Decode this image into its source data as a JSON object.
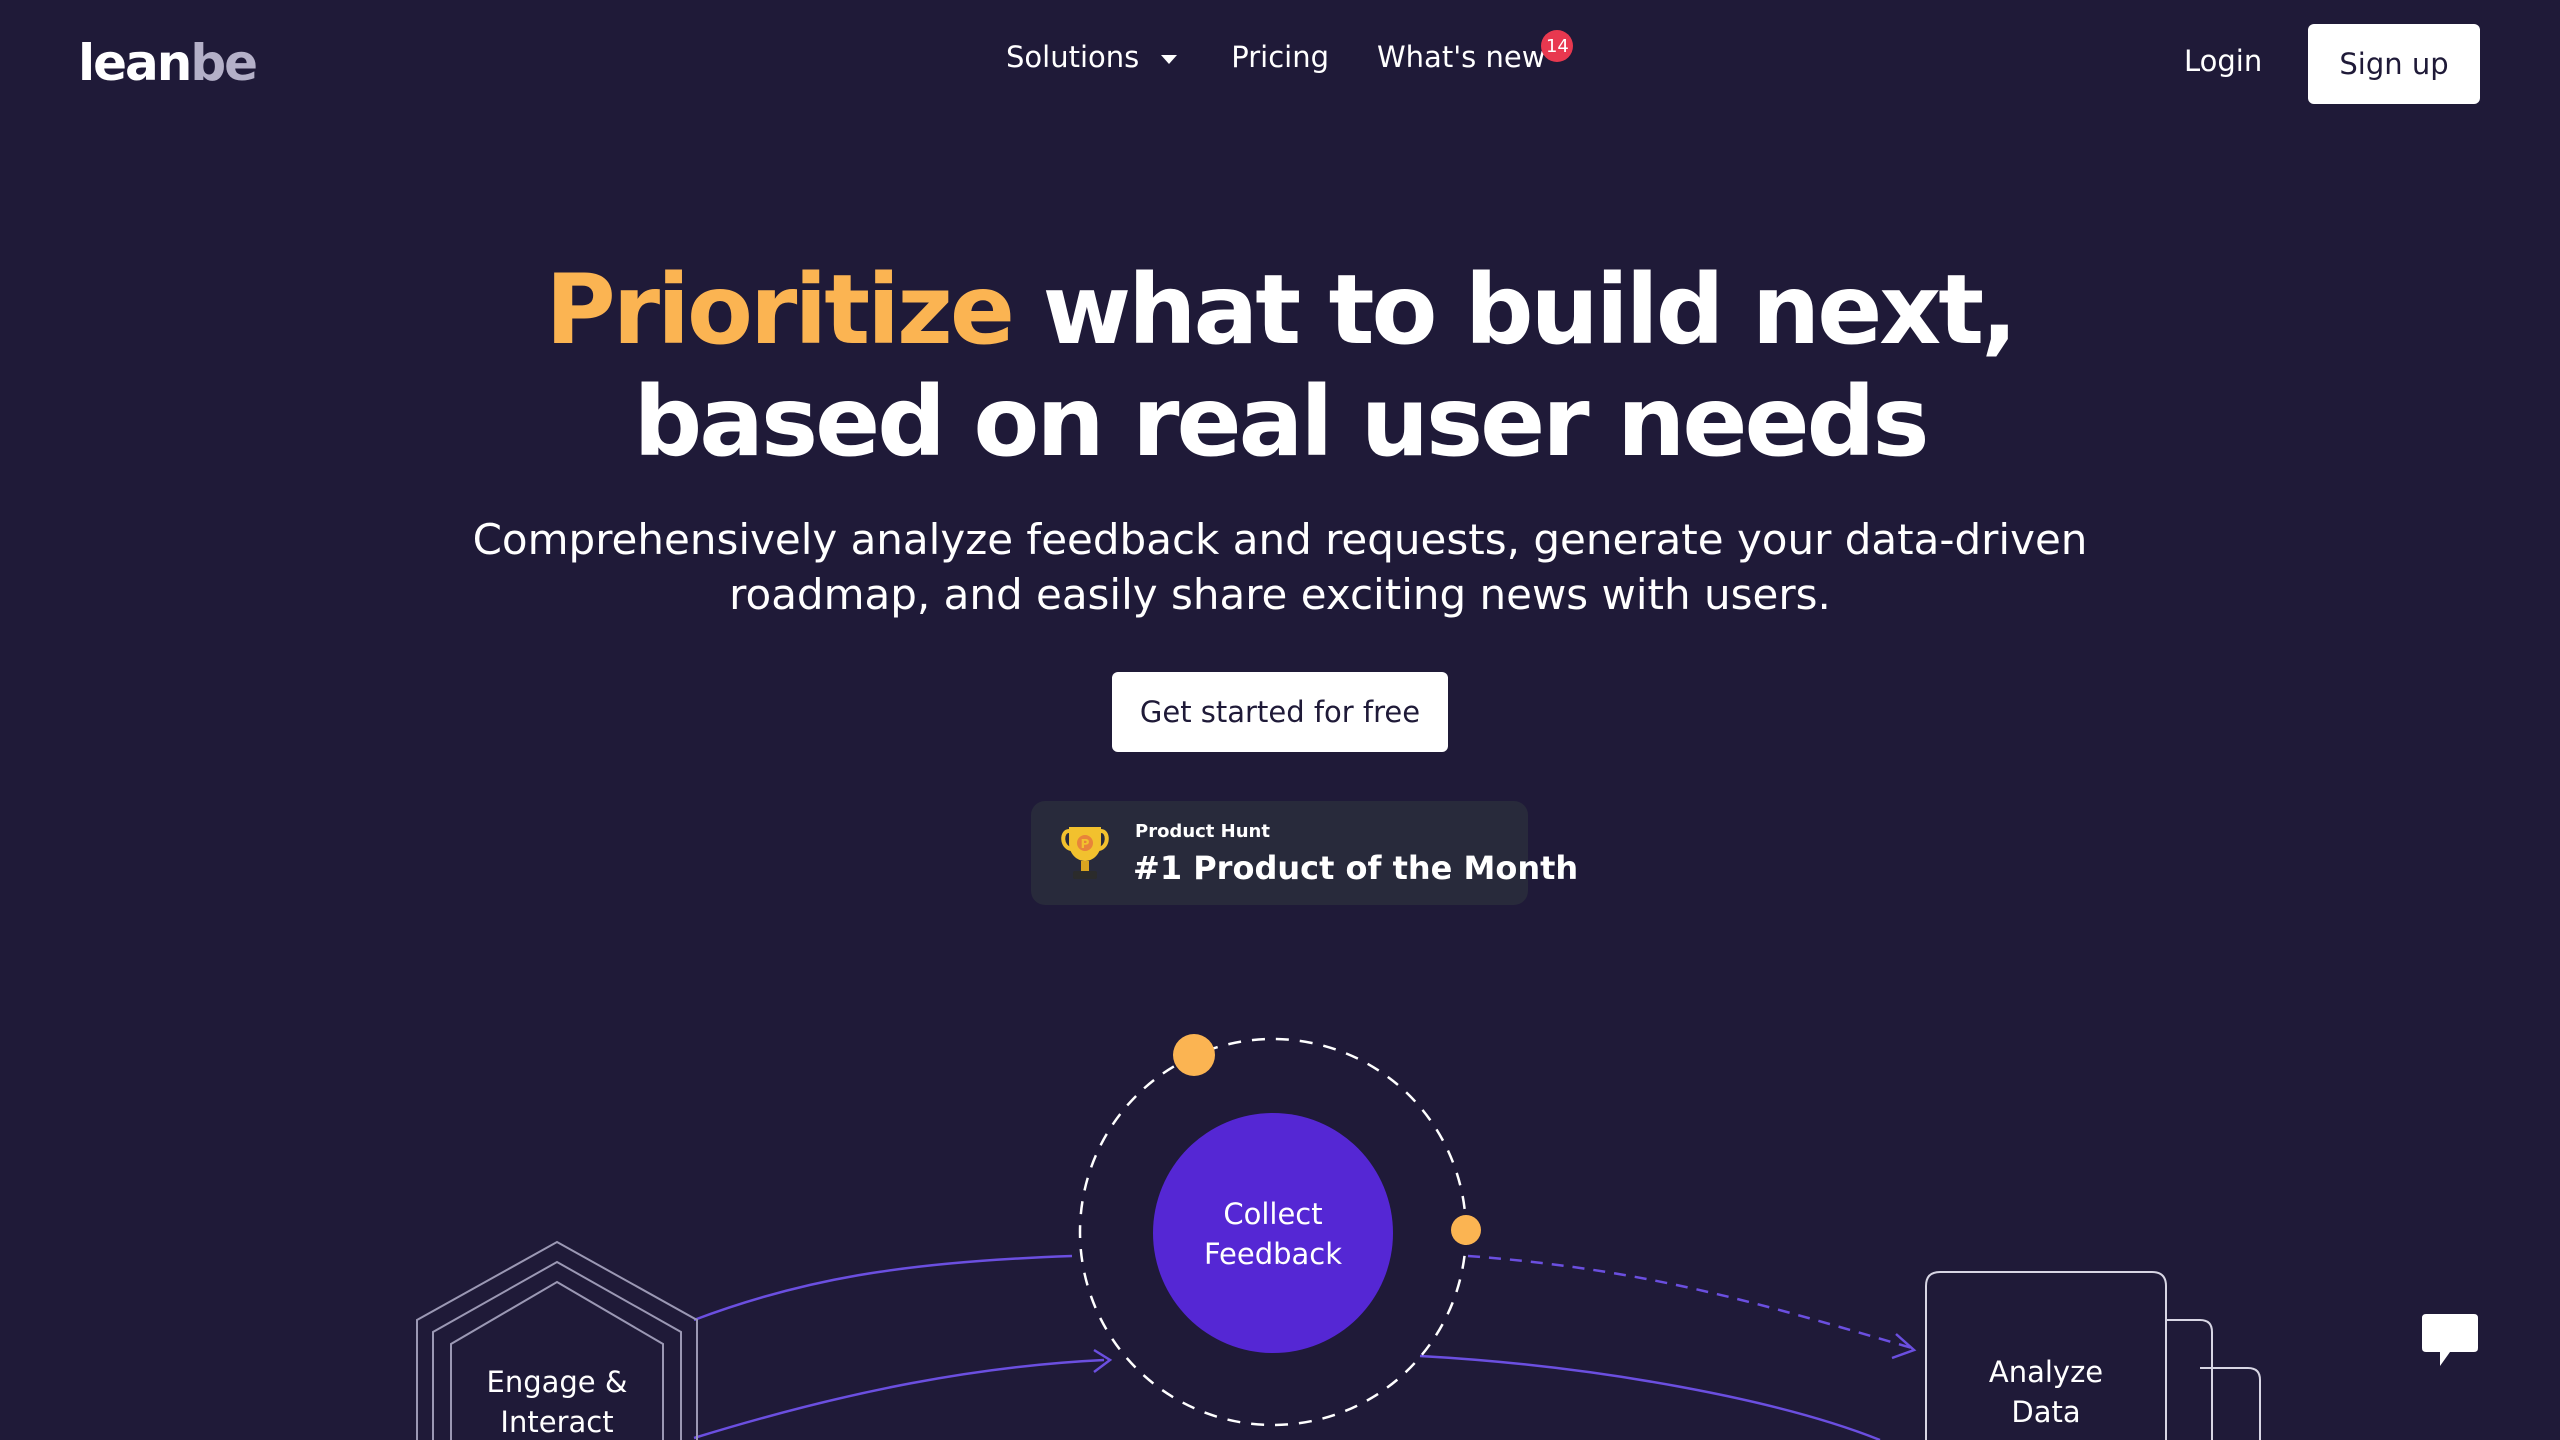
{
  "logo": {
    "part1": "lean",
    "part2": "be"
  },
  "nav": {
    "solutions": "Solutions",
    "pricing": "Pricing",
    "whats_new": "What's new",
    "whats_new_badge": "14"
  },
  "auth": {
    "login": "Login",
    "signup": "Sign up"
  },
  "hero": {
    "headline_accent": "Prioritize",
    "headline_rest_line1": "what to build next,",
    "headline_line2": "based on real user needs",
    "subtitle_line1": "Comprehensively analyze feedback and requests, generate your data-driven",
    "subtitle_line2": "roadmap, and easily share exciting news with users.",
    "cta": "Get started for free"
  },
  "product_hunt": {
    "label": "Product Hunt",
    "title": "#1 Product of the Month",
    "trophy_letter": "P"
  },
  "diagram": {
    "center_line1": "Collect",
    "center_line2": "Feedback",
    "left_line1": "Engage &",
    "left_line2": "Interact",
    "right_line1": "Analyze",
    "right_line2": "Data"
  },
  "colors": {
    "background": "#1f1a38",
    "accent": "#fbb452",
    "collect_circle": "#5527d4",
    "line_purple": "#6b4fe0",
    "badge": "#e8384f"
  },
  "icons": {
    "chat": "chat-icon",
    "trophy": "trophy-icon",
    "dropdown": "chevron-down-icon"
  }
}
